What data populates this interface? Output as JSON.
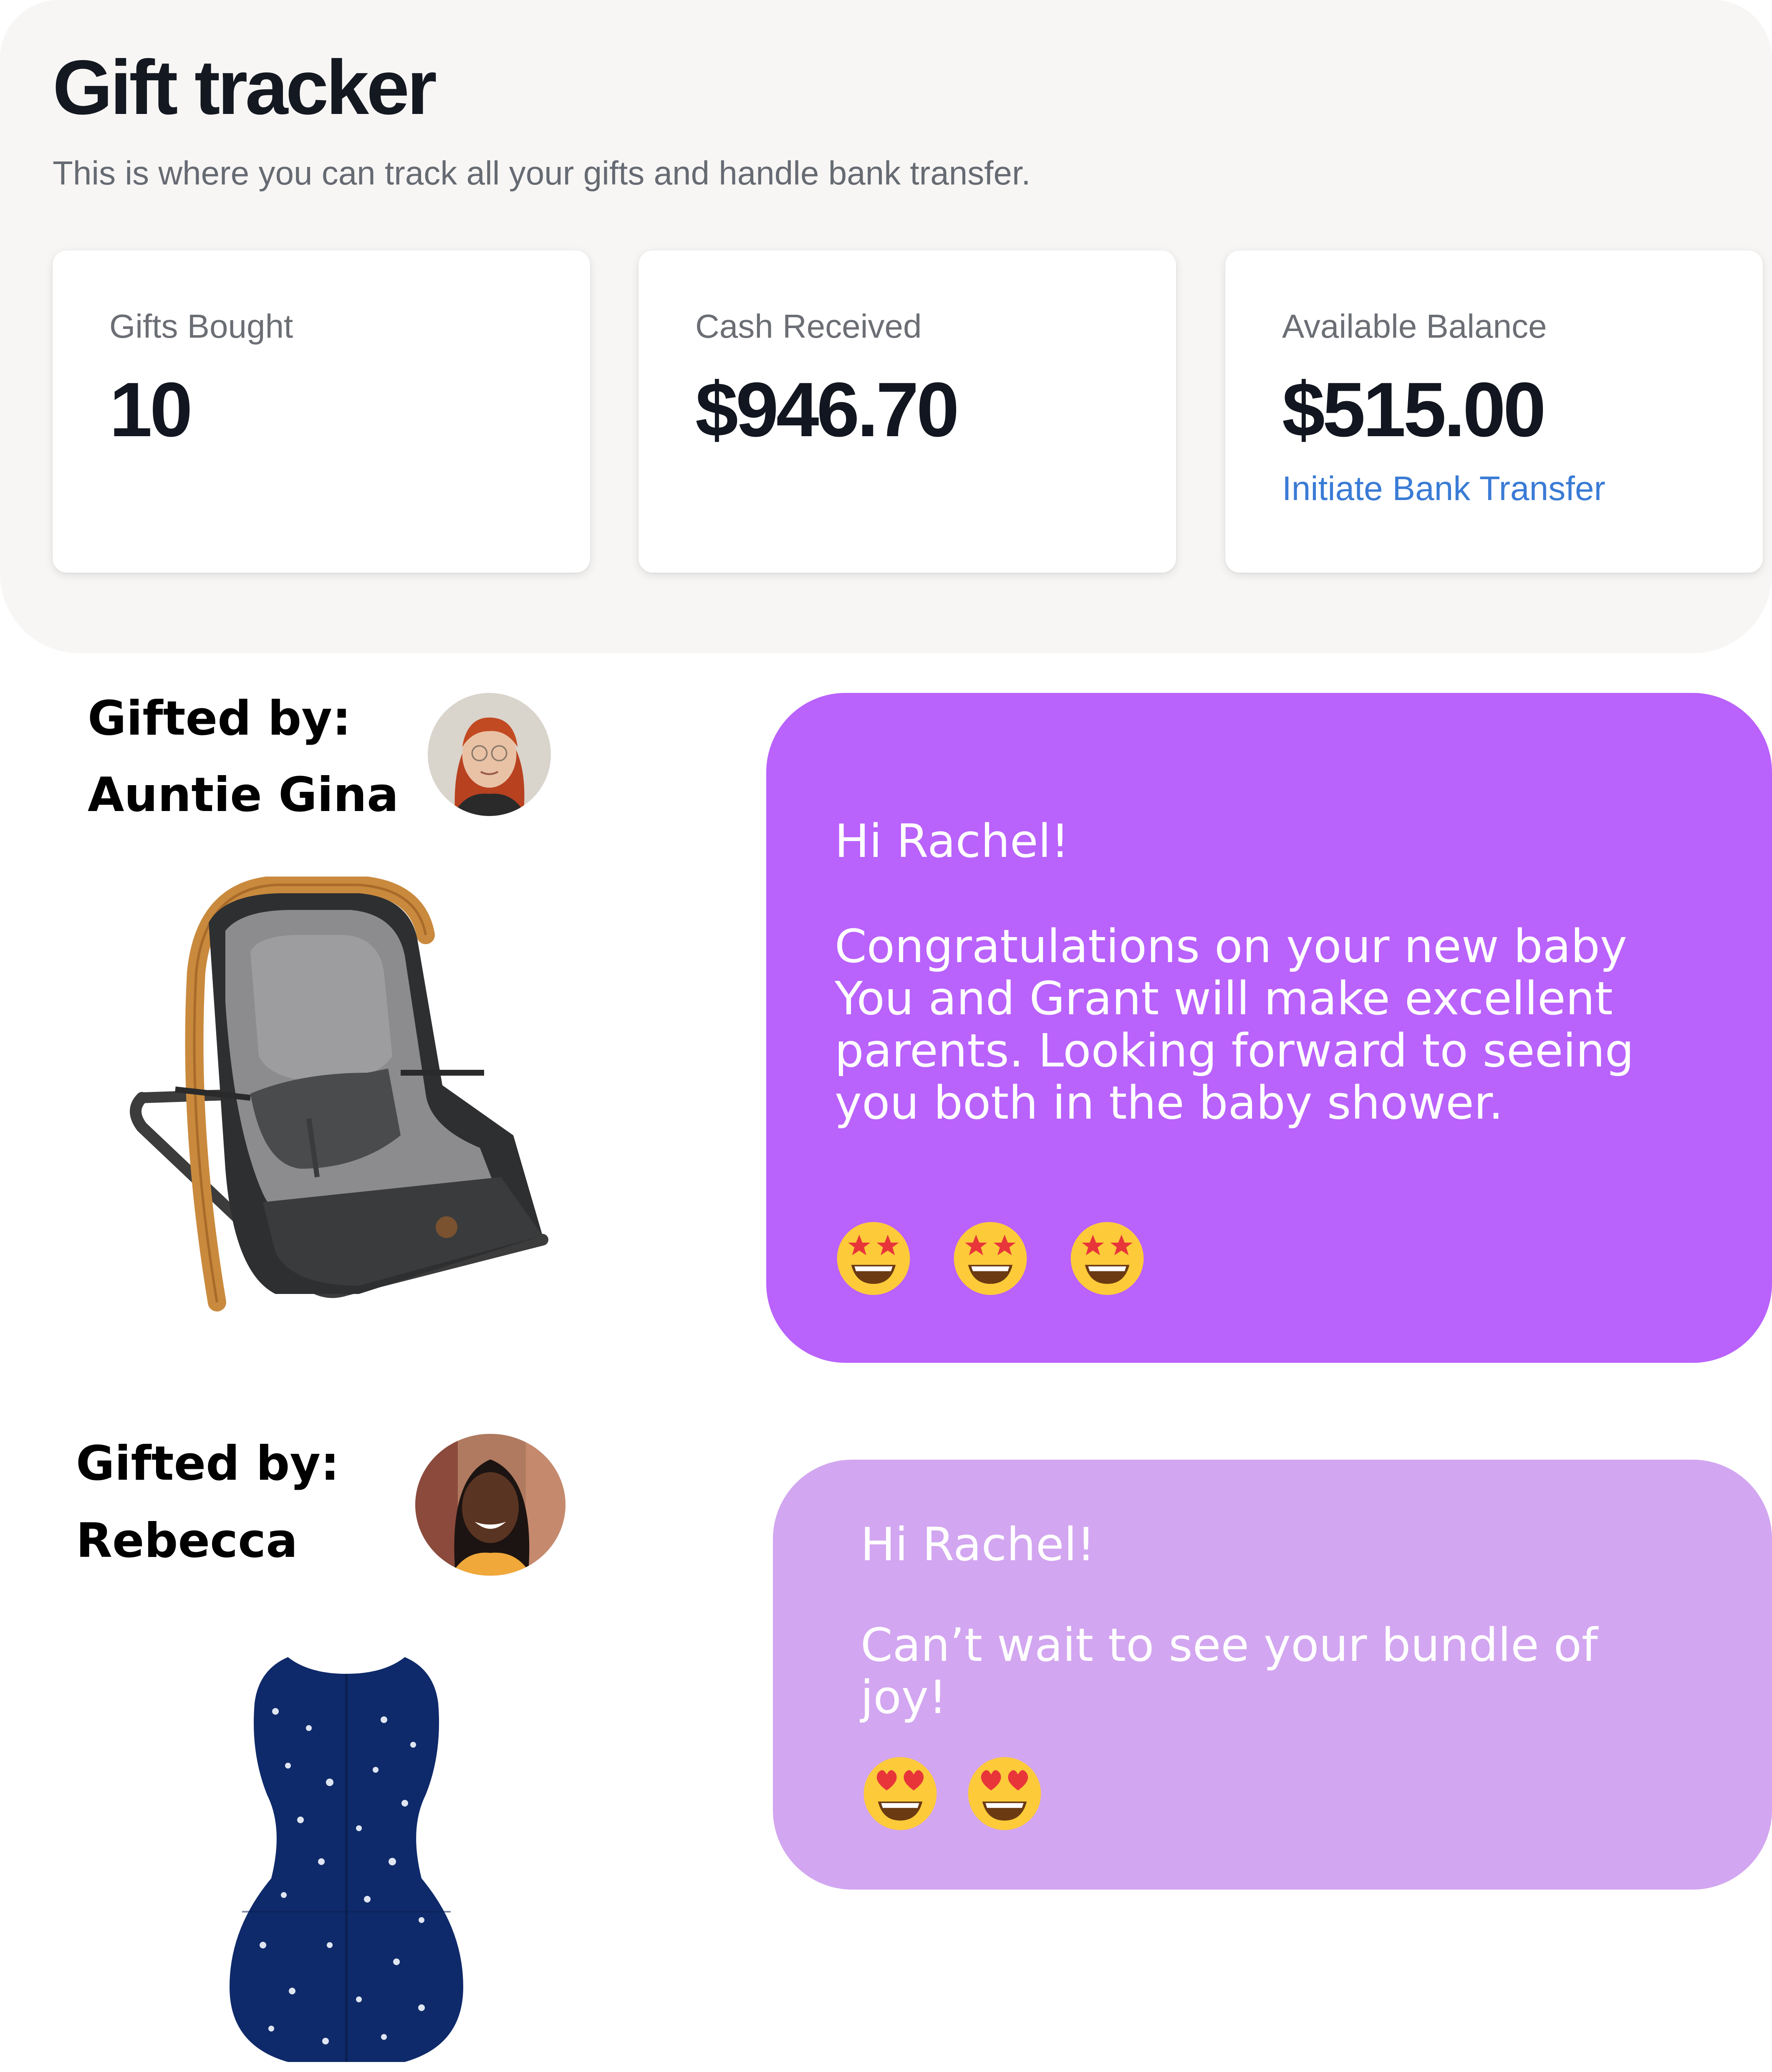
{
  "tracker": {
    "title": "Gift tracker",
    "subtitle": "This is where you can track all your gifts and handle bank transfer.",
    "cards": [
      {
        "label": "Gifts Bought",
        "value": "10"
      },
      {
        "label": "Cash Received",
        "value": "$946.70"
      },
      {
        "label": "Available Balance",
        "value": "$515.00",
        "link": "Initiate Bank Transfer"
      }
    ]
  },
  "gifts": [
    {
      "gifted_by_label": "Gifted by:",
      "giver": "Auntie Gina",
      "message_greeting": "Hi Rachel!",
      "message_body": "Congratulations on your new baby You and Grant will make excellent parents. Looking forward to seeing you both in the baby shower.",
      "emoji": "star-struck-face",
      "emoji_count": 3,
      "bubble_color": "#b962fc",
      "item": "baby bouncer"
    },
    {
      "gifted_by_label": "Gifted by:",
      "giver": "Rebecca",
      "message_greeting": "Hi Rachel!",
      "message_body": "Can’t wait to see your bundle of joy!",
      "emoji": "heart-eyes-face",
      "emoji_count": 2,
      "bubble_color": "#d2a6f0",
      "item": "baby swaddle"
    }
  ],
  "colors": {
    "panel_bg": "#f7f6f5",
    "link": "#3a7bd5",
    "heading": "#141821"
  }
}
